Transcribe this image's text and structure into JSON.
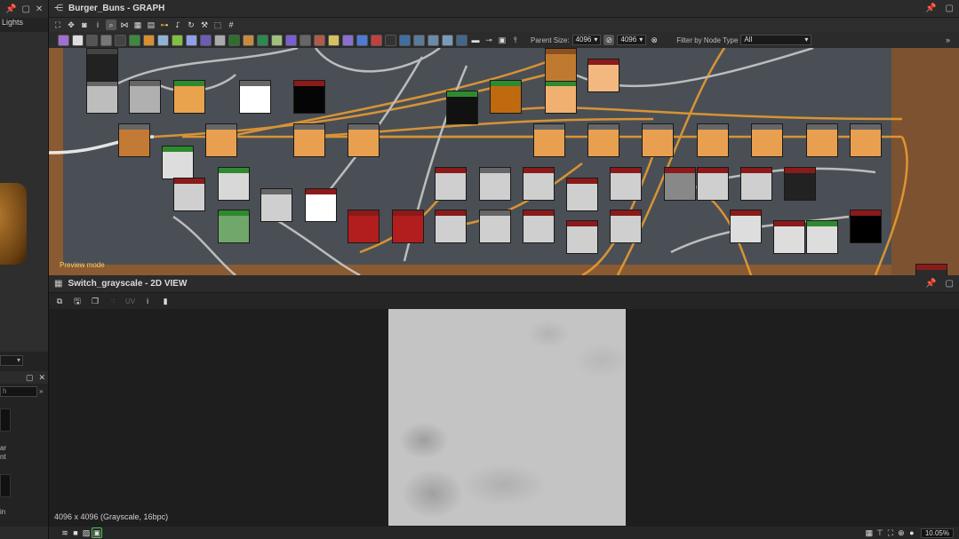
{
  "left_panel": {
    "tab_label": "Lights",
    "dropdown_value": "",
    "search_placeholder": "h",
    "library_labels": [
      "ar",
      "nt",
      "in"
    ]
  },
  "graph": {
    "title": "Burger_Buns - GRAPH",
    "parent_size_label": "Parent Size:",
    "parent_size_value": "4096",
    "output_size_value": "4096",
    "filter_label": "Filter by Node Type",
    "filter_value": "All",
    "preview_mode_label": "Preview mode",
    "colors": {
      "frame": "#8a5a32",
      "canvas": "#4a4f55",
      "link_orange": "#f0a030",
      "link_white": "#d8d8d8",
      "node_green_header": "#2f8a2f",
      "node_red_header": "#8b1a1a"
    }
  },
  "view2d": {
    "title": "Switch_grayscale - 2D VIEW",
    "uv_label": "UV",
    "info_text": "4096 x 4096 (Grayscale, 16bpc)",
    "zoom_value": "10.05%"
  }
}
